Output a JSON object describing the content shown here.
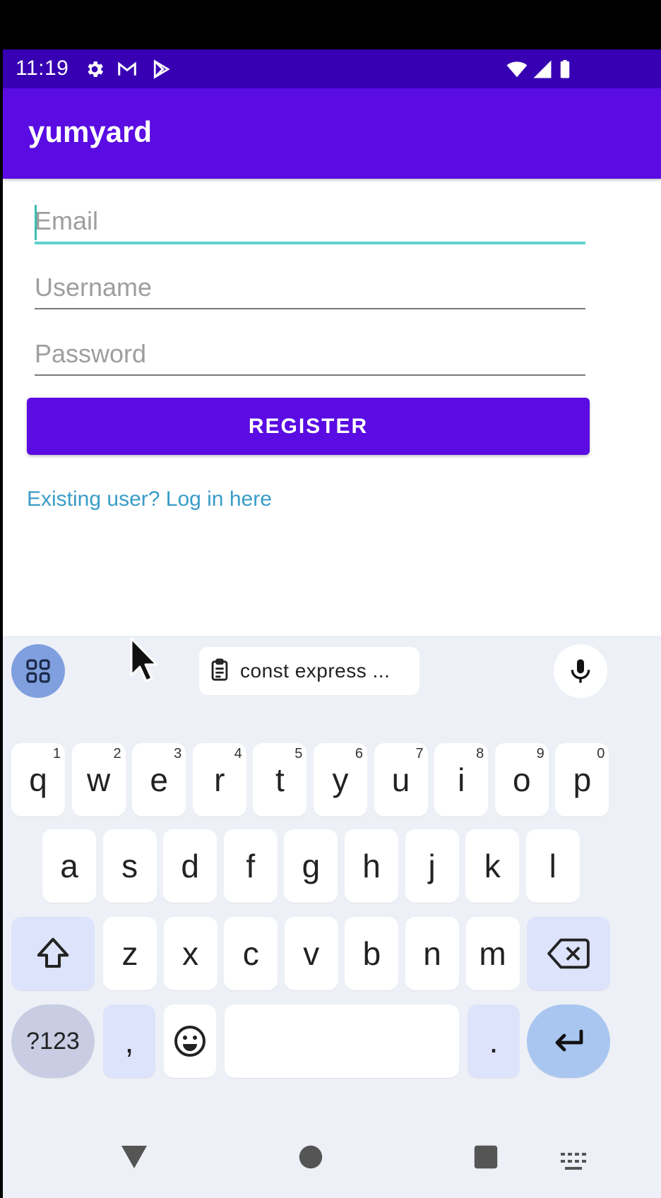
{
  "status_bar": {
    "time": "11:19",
    "icons_left": [
      "settings-icon",
      "gmail-icon",
      "play-store-icon"
    ],
    "icons_right": [
      "wifi-icon",
      "cell-signal-icon",
      "battery-icon"
    ]
  },
  "app_bar": {
    "title": "yumyard",
    "color": "#5a0ce2"
  },
  "form": {
    "email_placeholder": "Email",
    "username_placeholder": "Username",
    "password_placeholder": "Password",
    "register_label": "REGISTER",
    "login_link": "Existing user? Log in here"
  },
  "keyboard": {
    "clipboard_text": "const express ...",
    "row1": [
      {
        "k": "q",
        "h": "1"
      },
      {
        "k": "w",
        "h": "2"
      },
      {
        "k": "e",
        "h": "3"
      },
      {
        "k": "r",
        "h": "4"
      },
      {
        "k": "t",
        "h": "5"
      },
      {
        "k": "y",
        "h": "6"
      },
      {
        "k": "u",
        "h": "7"
      },
      {
        "k": "i",
        "h": "8"
      },
      {
        "k": "o",
        "h": "9"
      },
      {
        "k": "p",
        "h": "0"
      }
    ],
    "row2": [
      "a",
      "s",
      "d",
      "f",
      "g",
      "h",
      "j",
      "k",
      "l"
    ],
    "row3": [
      "z",
      "x",
      "c",
      "v",
      "b",
      "n",
      "m"
    ],
    "symbols_label": "?123",
    "comma": ",",
    "period": "."
  },
  "colors": {
    "status_bar": "#3700b3",
    "accent": "#5a0ce2",
    "focus": "#5fd3cc",
    "link": "#3a9cc7"
  }
}
